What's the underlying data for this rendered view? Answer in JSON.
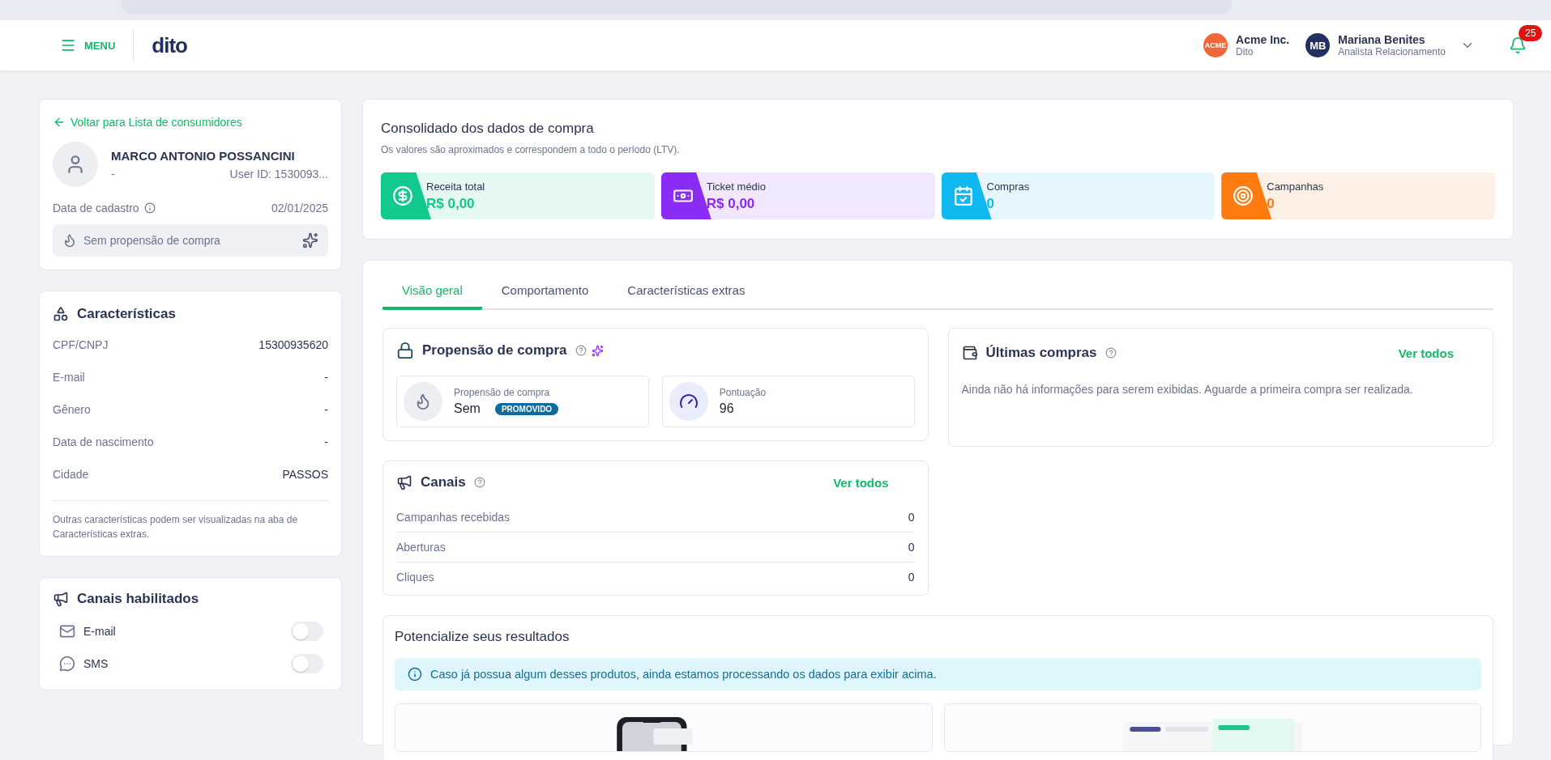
{
  "header": {
    "menu_label": "MENU",
    "logo": "dito",
    "account": {
      "badge": "ACME",
      "name": "Acme Inc.",
      "subtitle": "Dito"
    },
    "user": {
      "initials": "MB",
      "name": "Mariana Benites",
      "role": "Analista Relacionamento"
    },
    "notifications": "25"
  },
  "profile": {
    "back_link": "Voltar para Lista de consumidores",
    "name": "MARCO ANTONIO POSSANCINI",
    "subtitle": "-",
    "user_id": "User ID: 1530093...",
    "signup_label": "Data de cadastro",
    "signup_date": "02/01/2025",
    "propensity": "Sem propensão de compra"
  },
  "characteristics": {
    "title": "Características",
    "rows": [
      {
        "label": "CPF/CNPJ",
        "value": "15300935620"
      },
      {
        "label": "E-mail",
        "value": "-"
      },
      {
        "label": "Gênero",
        "value": "-"
      },
      {
        "label": "Data de nascimento",
        "value": "-"
      },
      {
        "label": "Cidade",
        "value": "PASSOS"
      }
    ],
    "note": "Outras características podem ser visualizadas na aba de Características extras."
  },
  "enabled_channels": {
    "title": "Canais habilitados",
    "items": [
      {
        "kind": "email",
        "label": "E-mail",
        "on": false
      },
      {
        "kind": "sms",
        "label": "SMS",
        "on": false
      }
    ]
  },
  "summary": {
    "title": "Consolidado dos dados de compra",
    "subtitle": "Os valores são aproximados e correspondem a todo o período (LTV).",
    "metrics": [
      {
        "kind": "revenue",
        "label": "Receita total",
        "value": "R$ 0,00",
        "color": "#12c98d"
      },
      {
        "kind": "ticket",
        "label": "Ticket médio",
        "value": "R$ 0,00",
        "color": "#8a2cf5"
      },
      {
        "kind": "purchases",
        "label": "Compras",
        "value": "0",
        "color": "#0fb8f0"
      },
      {
        "kind": "campaigns",
        "label": "Campanhas",
        "value": "0",
        "color": "#ff7a0f"
      }
    ]
  },
  "tabs": [
    {
      "label": "Visão geral",
      "selected": true
    },
    {
      "label": "Comportamento",
      "selected": false
    },
    {
      "label": "Características extras",
      "selected": false
    }
  ],
  "propensity_card": {
    "title": "Propensão de compra",
    "stats": [
      {
        "kind": "propensity",
        "label": "Propensão de compra",
        "value": "Sem",
        "tag": "PROMOVIDO"
      },
      {
        "kind": "score",
        "label": "Pontuação",
        "value": "96"
      }
    ]
  },
  "last_purchases": {
    "title": "Últimas compras",
    "link": "Ver todos",
    "empty": "Ainda não há informações para serem exibidas. Aguarde a primeira compra ser realizada."
  },
  "channels": {
    "title": "Canais",
    "link": "Ver todos",
    "rows": [
      {
        "label": "Campanhas recebidas",
        "value": "0"
      },
      {
        "label": "Aberturas",
        "value": "0"
      },
      {
        "label": "Cliques",
        "value": "0"
      }
    ]
  },
  "boost": {
    "title": "Potencialize seus resultados",
    "notice": "Caso já possua algum desses produtos, ainda estamos processando os dados para exibir acima."
  }
}
